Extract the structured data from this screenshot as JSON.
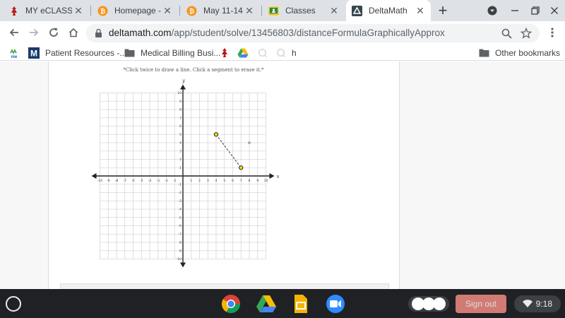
{
  "browser": {
    "tabs": [
      {
        "title": "MY eCLASS |",
        "active": false,
        "icon": "eclass-icon"
      },
      {
        "title": "Homepage - 2",
        "active": false,
        "icon": "bitcoin-orange-icon"
      },
      {
        "title": "May 11-14, 20",
        "active": false,
        "icon": "bitcoin-orange-icon"
      },
      {
        "title": "Classes",
        "active": false,
        "icon": "google-classroom-icon"
      },
      {
        "title": "DeltaMath",
        "active": true,
        "icon": "deltamath-icon"
      }
    ],
    "close_glyph": "✕",
    "new_tab_glyph": "+",
    "url": {
      "host": "deltamath.com",
      "path": "/app/student/solve/13456803/distanceFormulaGraphicallyApprox"
    },
    "bookmarks": [
      {
        "label": "",
        "icon": "ime-icon"
      },
      {
        "label": "Patient Resources -...",
        "icon": "m-logo-icon"
      },
      {
        "label": "Medical Billing Busi...",
        "icon": "folder-icon"
      },
      {
        "label": "",
        "icon": "eclass-icon"
      },
      {
        "label": "",
        "icon": "google-drive-icon"
      },
      {
        "label": "",
        "icon": "q-icon"
      },
      {
        "label": "",
        "icon": "q-icon"
      },
      {
        "label": "h",
        "icon": ""
      }
    ],
    "other_bookmarks": "Other bookmarks"
  },
  "problem": {
    "instruction": "*Click twice to draw a line. Click a segment to erase it.*"
  },
  "chart_data": {
    "type": "scatter",
    "xlabel": "x",
    "ylabel": "y",
    "xlim": [
      -10,
      10
    ],
    "ylim": [
      -10,
      10
    ],
    "grid": true,
    "tick_labels": [
      "-10",
      "-9",
      "-8",
      "-7",
      "-6",
      "-5",
      "-4",
      "-3",
      "-2",
      "-1",
      "1",
      "2",
      "3",
      "4",
      "5",
      "6",
      "7",
      "8",
      "9",
      "10"
    ],
    "points": [
      {
        "x": 4,
        "y": 5,
        "style": "endpoint"
      },
      {
        "x": 7,
        "y": 1,
        "style": "endpoint"
      },
      {
        "x": 8,
        "y": 4,
        "style": "ghost"
      }
    ],
    "segments": [
      {
        "from": [
          4,
          5
        ],
        "to": [
          7,
          1
        ],
        "dash": true
      }
    ],
    "colors": {
      "endpoint_fill": "#f2e600",
      "ghost": "#aaaaaa",
      "grid": "#d6d6d6",
      "axis": "#222222"
    }
  },
  "shelf": {
    "apps": [
      "chrome-icon",
      "google-drive-icon",
      "google-slides-icon",
      "zoom-icon"
    ],
    "signout_label": "Sign out",
    "time": "9:18"
  }
}
